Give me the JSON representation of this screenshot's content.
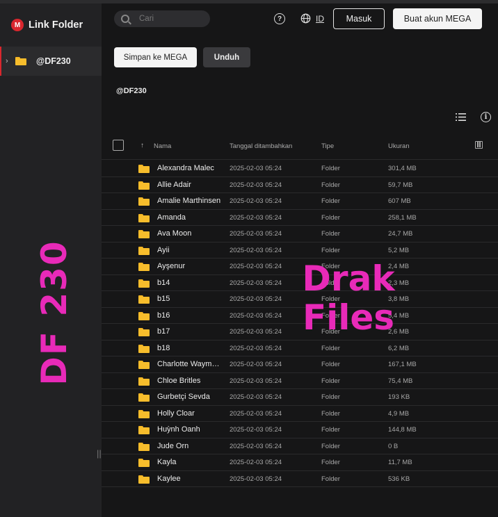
{
  "sidebar": {
    "brand_logo_letter": "M",
    "brand_title": "Link Folder",
    "item_label": "@DF230",
    "chevron": "›",
    "resize_handle": "||"
  },
  "header": {
    "search_placeholder": "Cari",
    "help_symbol": "?",
    "language": "ID",
    "login_label": "Masuk",
    "signup_label": "Buat akun MEGA"
  },
  "actions": {
    "save_label": "Simpan ke MEGA",
    "download_label": "Unduh"
  },
  "breadcrumb": "@DF230",
  "info_symbol": "i",
  "table": {
    "sort_arrow": "↑",
    "headers": {
      "name": "Nama",
      "date": "Tanggal ditambahkan",
      "type": "Tipe",
      "size": "Ukuran"
    },
    "rows": [
      {
        "name": "Alexandra Malec",
        "date": "2025-02-03 05:24",
        "type": "Folder",
        "size": "301,4 MB"
      },
      {
        "name": "Allie Adair",
        "date": "2025-02-03 05:24",
        "type": "Folder",
        "size": "59,7 MB"
      },
      {
        "name": "Amalie Marthinsen",
        "date": "2025-02-03 05:24",
        "type": "Folder",
        "size": "607 MB"
      },
      {
        "name": "Amanda",
        "date": "2025-02-03 05:24",
        "type": "Folder",
        "size": "258,1 MB"
      },
      {
        "name": "Ava Moon",
        "date": "2025-02-03 05:24",
        "type": "Folder",
        "size": "24,7 MB"
      },
      {
        "name": "Ayii",
        "date": "2025-02-03 05:24",
        "type": "Folder",
        "size": "5,2 MB"
      },
      {
        "name": "Ayşenur",
        "date": "2025-02-03 05:24",
        "type": "Folder",
        "size": "2,4 MB"
      },
      {
        "name": "b14",
        "date": "2025-02-03 05:24",
        "type": "Folder",
        "size": "2,3 MB"
      },
      {
        "name": "b15",
        "date": "2025-02-03 05:24",
        "type": "Folder",
        "size": "3,8 MB"
      },
      {
        "name": "b16",
        "date": "2025-02-03 05:24",
        "type": "Folder",
        "size": "5,4 MB"
      },
      {
        "name": "b17",
        "date": "2025-02-03 05:24",
        "type": "Folder",
        "size": "2,6 MB"
      },
      {
        "name": "b18",
        "date": "2025-02-03 05:24",
        "type": "Folder",
        "size": "6,2 MB"
      },
      {
        "name": "Charlotte Waymouth",
        "date": "2025-02-03 05:24",
        "type": "Folder",
        "size": "167,1 MB"
      },
      {
        "name": "Chloe Britles",
        "date": "2025-02-03 05:24",
        "type": "Folder",
        "size": "75,4 MB"
      },
      {
        "name": "Gurbetçi Sevda",
        "date": "2025-02-03 05:24",
        "type": "Folder",
        "size": "193 KB"
      },
      {
        "name": "Holly Cloar",
        "date": "2025-02-03 05:24",
        "type": "Folder",
        "size": "4,9 MB"
      },
      {
        "name": "Huỳnh Oanh",
        "date": "2025-02-03 05:24",
        "type": "Folder",
        "size": "144,8 MB"
      },
      {
        "name": "Jude Orn",
        "date": "2025-02-03 05:24",
        "type": "Folder",
        "size": "0 B"
      },
      {
        "name": "Kayla",
        "date": "2025-02-03 05:24",
        "type": "Folder",
        "size": "11,7 MB"
      },
      {
        "name": "Kaylee",
        "date": "2025-02-03 05:24",
        "type": "Folder",
        "size": "536 KB"
      }
    ]
  },
  "overlays": {
    "left_text": "DF 230",
    "center_line1": "Drak",
    "center_line2": "Files"
  },
  "colors": {
    "accent": "#d9272e",
    "folder": "#f7bd2c",
    "watermark": "#e82ab8"
  }
}
